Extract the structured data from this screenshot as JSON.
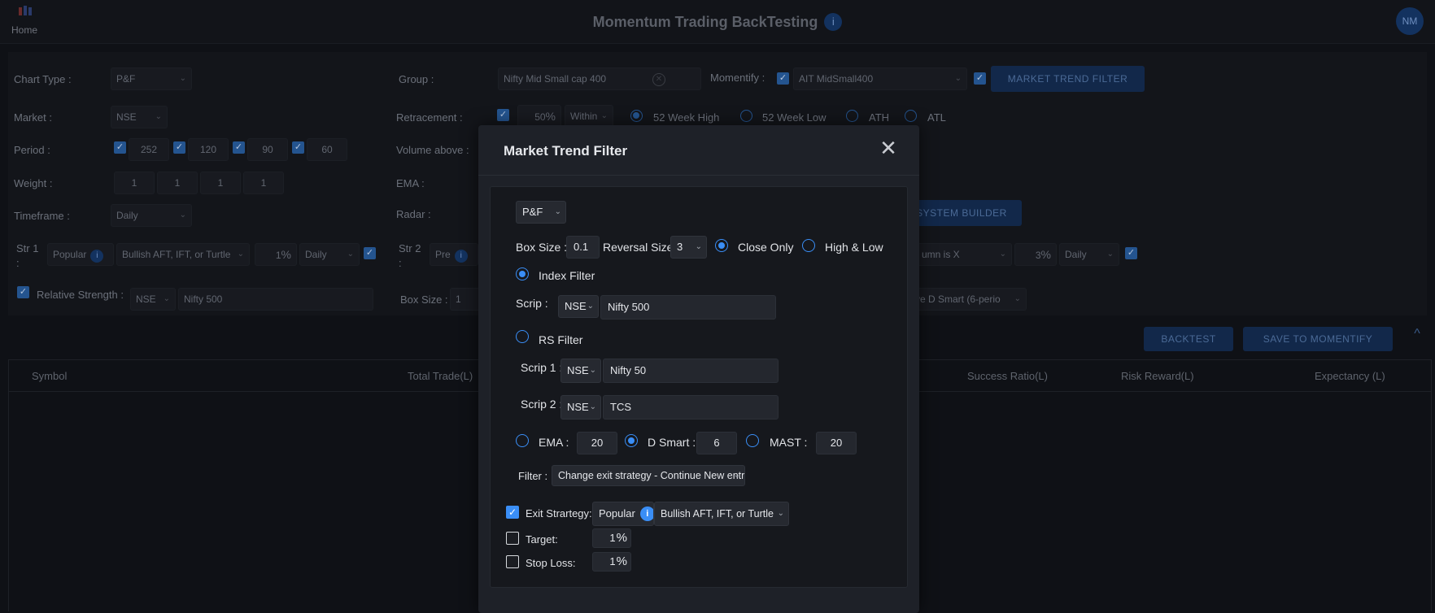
{
  "app": {
    "title": "Momentum Trading BackTesting",
    "home": "Home",
    "avatar": "NM",
    "info_glyph": "i"
  },
  "form": {
    "chart_type": {
      "label": "Chart Type :",
      "value": "P&F"
    },
    "market": {
      "label": "Market :",
      "value": "NSE"
    },
    "period": {
      "label": "Period :",
      "values": [
        "252",
        "120",
        "90",
        "60"
      ]
    },
    "weight": {
      "label": "Weight :",
      "values": [
        "1",
        "1",
        "1",
        "1"
      ]
    },
    "timeframe": {
      "label": "Timeframe :",
      "value": "Daily"
    },
    "str1": {
      "label": "Str 1",
      "colon": ":",
      "mode": "Popular",
      "strategy": "Bullish AFT, IFT, or Turtle",
      "pct": "1",
      "tf": "Daily"
    },
    "relative_strength": {
      "label": "Relative Strength :",
      "exchange": "NSE",
      "scrip": "Nifty 500"
    },
    "group": {
      "label": "Group :",
      "value": "Nifty Mid Small cap 400"
    },
    "momentify": {
      "label": "Momentify :",
      "value": "AIT MidSmall400"
    },
    "market_trend_filter_button": "MARKET TREND FILTER",
    "retracement": {
      "label": "Retracement :",
      "pct": "50",
      "mode": "Within",
      "options": [
        "52 Week High",
        "52 Week Low",
        "ATH",
        "ATL"
      ]
    },
    "volume_above": {
      "label": "Volume above :"
    },
    "ema": {
      "label": "EMA :"
    },
    "radar": {
      "label": "Radar :"
    },
    "system_builder_button": "SYSTEM BUILDER",
    "str2": {
      "label": "Str 2",
      "colon": ":",
      "mode": "Pre",
      "strategy_tail": "umn is X",
      "pct": "3",
      "tf": "Daily"
    },
    "box_size": {
      "label": "Box Size :",
      "value": "1"
    },
    "dsmart_tail": "ve D Smart (6-perio"
  },
  "actions": {
    "backtest": "BACKTEST",
    "save": "SAVE TO MOMENTIFY",
    "collapse": "^"
  },
  "table": {
    "columns": [
      "Symbol",
      "Total Trade(L)",
      "Success Ratio(L)",
      "Risk Reward(L)",
      "Expectancy (L)"
    ]
  },
  "modal": {
    "title": "Market Trend Filter",
    "close": "✕",
    "chart_type": "P&F",
    "box_size": {
      "label": "Box Size :",
      "value": "0.1"
    },
    "reversal_size": {
      "label": "Reversal Size:",
      "value": "3"
    },
    "close_only": "Close Only",
    "high_low": "High & Low",
    "index_filter": "Index Filter",
    "scrip": {
      "label": "Scrip :",
      "exchange": "NSE",
      "value": "Nifty 500"
    },
    "rs_filter": "RS Filter",
    "scrip1": {
      "label": "Scrip 1 :",
      "exchange": "NSE",
      "value": "Nifty 50"
    },
    "scrip2": {
      "label": "Scrip 2 :",
      "exchange": "NSE",
      "value": "TCS"
    },
    "ema": {
      "label": "EMA :",
      "value": "20"
    },
    "dsmart": {
      "label": "D Smart :",
      "value": "6"
    },
    "mast": {
      "label": "MAST :",
      "value": "20"
    },
    "filter": {
      "label": "Filter :",
      "value": "Change exit strategy - Continue New entry"
    },
    "exit_strategy": {
      "label": "Exit Strartegy:",
      "mode": "Popular",
      "value": "Bullish AFT, IFT, or Turtle"
    },
    "target": {
      "label": "Target:",
      "value": "1"
    },
    "stop_loss": {
      "label": "Stop Loss:",
      "value": "1"
    },
    "percent_symbol": "%",
    "check_glyph": "✓",
    "chevron_glyph": "⌄"
  }
}
